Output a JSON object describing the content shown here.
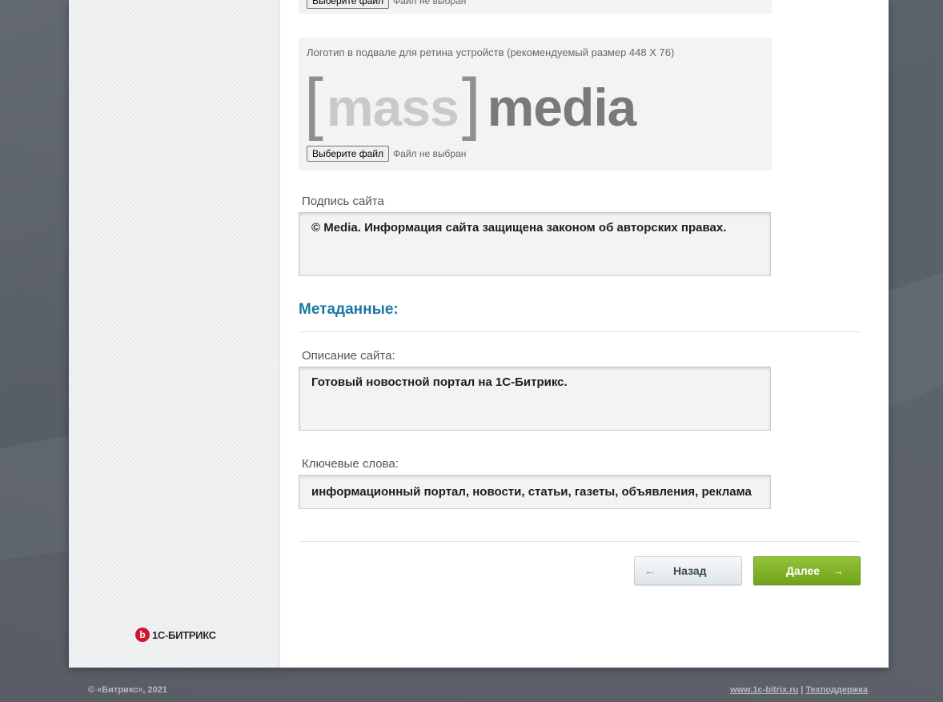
{
  "footer_logo": {
    "label": "Логотип в подвале для ретина устройств (рекомендуемый размер 448 X 76)",
    "logo_text": {
      "open": "[",
      "mass": "mass",
      "close": "]",
      "media": "media"
    },
    "file_button": "Выберите файл",
    "file_status": "Файл не выбран"
  },
  "top_file": {
    "file_button": "Выберите файл",
    "file_status": "Файл не выбран"
  },
  "site_signature": {
    "label": "Подпись сайта",
    "value": "© Media. Информация сайта защищена законом об авторских правах."
  },
  "metadata": {
    "title": "Метаданные:",
    "description_label": "Описание сайта:",
    "description_value": "Готовый новостной портал на 1С-Битрикс.",
    "keywords_label": "Ключевые слова:",
    "keywords_value": "информационный портал, новости, статьи, газеты, объявления, реклама"
  },
  "nav": {
    "back_label": "Назад",
    "back_arrow": "←",
    "next_label": "Далее",
    "next_arrow": "→"
  },
  "brand": {
    "mark": "b",
    "name": "1С-БИТРИКС"
  },
  "footer": {
    "copyright": "© «Битрикс», 2021",
    "site_link": "www.1c-bitrix.ru",
    "separator": "|",
    "support_link": "Техподдержка"
  },
  "colors": {
    "accent": "#1b77a2",
    "next_button": "#7fb22a",
    "brand_red": "#d0152c"
  }
}
